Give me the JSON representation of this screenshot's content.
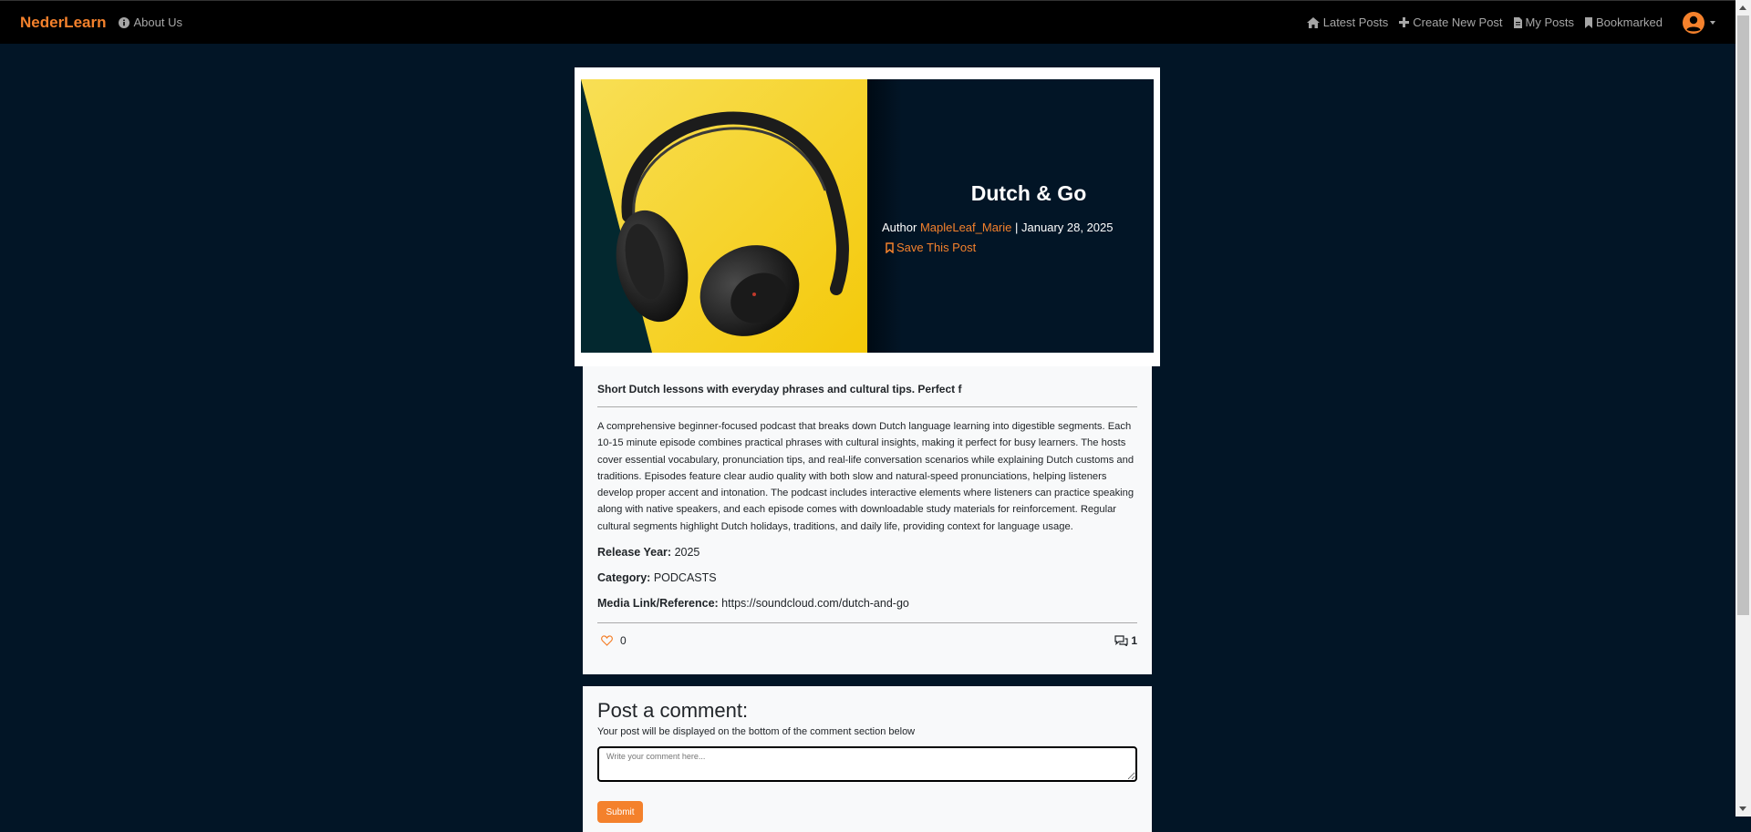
{
  "nav": {
    "brand": "NederLearn",
    "about": "About Us",
    "latest_posts": "Latest Posts",
    "create_post": "Create New Post",
    "my_posts": "My Posts",
    "bookmarked": "Bookmarked"
  },
  "post": {
    "title": "Dutch & Go",
    "author_label": "Author",
    "author": "MapleLeaf_Marie",
    "separator": "|",
    "date": "January 28, 2025",
    "save_label": "Save This Post",
    "excerpt": "Short Dutch lessons with everyday phrases and cultural tips. Perfect f",
    "description": "A comprehensive beginner-focused podcast that breaks down Dutch language learning into digestible segments. Each 10-15 minute episode combines practical phrases with cultural insights, making it perfect for busy learners. The hosts cover essential vocabulary, pronunciation tips, and real-life conversation scenarios while explaining Dutch customs and traditions. Episodes feature clear audio quality with both slow and natural-speed pronunciations, helping listeners develop proper accent and intonation. The podcast includes interactive elements where listeners can practice speaking along with native speakers, and each episode comes with downloadable study materials for reinforcement. Regular cultural segments highlight Dutch holidays, traditions, and daily life, providing context for language usage.",
    "release_year_label": "Release Year:",
    "release_year": "2025",
    "category_label": "Category:",
    "category": "PODCASTS",
    "media_label": "Media Link/Reference:",
    "media_link": "https://soundcloud.com/dutch-and-go",
    "likes": "0",
    "comments": "1"
  },
  "comment_form": {
    "heading": "Post a comment:",
    "hint": "Your post will be displayed on the bottom of the comment section below",
    "placeholder": "Write your comment here...",
    "submit": "Submit"
  },
  "colors": {
    "accent": "#f4812c",
    "background": "#021526",
    "navbar": "#000000"
  },
  "icons": {
    "about": "info-circle-icon",
    "latest_posts": "home-icon",
    "create_post": "plus-icon",
    "my_posts": "file-icon",
    "bookmarked": "bookmark-icon",
    "user": "user-circle-icon",
    "save": "bookmark-outline-icon",
    "like": "heart-outline-icon",
    "comments": "comments-icon"
  }
}
